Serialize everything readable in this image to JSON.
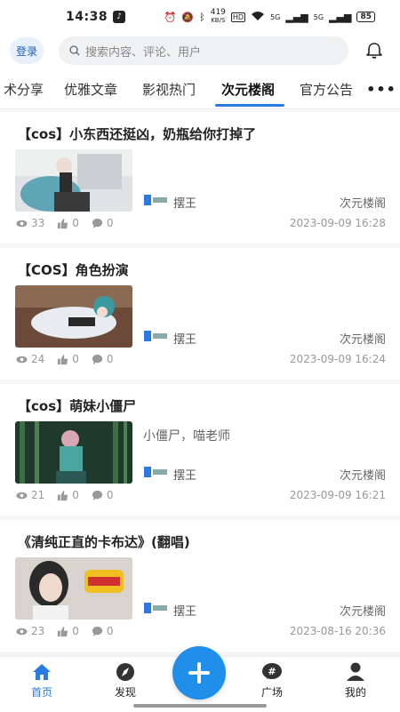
{
  "status": {
    "time": "14:38",
    "speed": "419",
    "speed_unit": "KB/S",
    "hd": "HD",
    "signal1": "5G",
    "signal2": "5G",
    "battery": "85"
  },
  "header": {
    "login_label": "登录",
    "search_placeholder": "搜索内容、评论、用户"
  },
  "tabs": [
    {
      "label": "术分享"
    },
    {
      "label": "优雅文章"
    },
    {
      "label": "影视热门"
    },
    {
      "label": "次元楼阁"
    },
    {
      "label": "官方公告"
    }
  ],
  "more_label": "•••",
  "posts": [
    {
      "title": "【cos】小东西还挺凶，奶瓶给你打掉了",
      "excerpt": "",
      "author": "摆王",
      "category": "次元楼阁",
      "views": "33",
      "likes": "0",
      "comments": "0",
      "date": "2023-09-09 16:28"
    },
    {
      "title": "【COS】角色扮演",
      "excerpt": "",
      "author": "摆王",
      "category": "次元楼阁",
      "views": "24",
      "likes": "0",
      "comments": "0",
      "date": "2023-09-09 16:24"
    },
    {
      "title": "【cos】萌妹小僵尸",
      "excerpt": "小僵尸，喵老师",
      "author": "摆王",
      "category": "次元楼阁",
      "views": "21",
      "likes": "0",
      "comments": "0",
      "date": "2023-09-09 16:21"
    },
    {
      "title": "《清纯正直的卡布达》(翻唱)",
      "excerpt": "",
      "author": "摆王",
      "category": "次元楼阁",
      "views": "23",
      "likes": "0",
      "comments": "0",
      "date": "2023-08-16 20:36"
    }
  ],
  "nav": [
    {
      "label": "首页"
    },
    {
      "label": "发现"
    },
    {
      "label": "广场"
    },
    {
      "label": "我的"
    }
  ],
  "colors": {
    "accent": "#2a7be0",
    "fab": "#1f8fe9"
  }
}
